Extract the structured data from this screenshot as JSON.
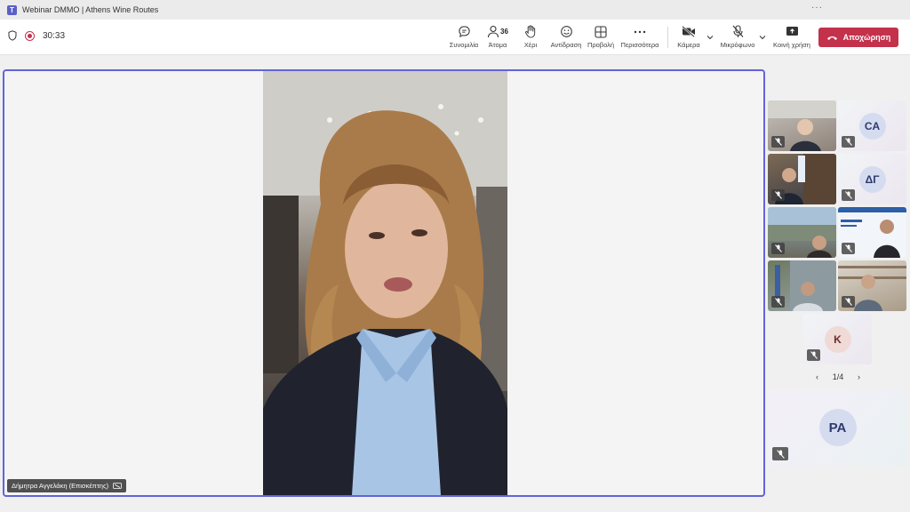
{
  "window": {
    "title": "Webinar DMMO | Athens Wine Routes",
    "more": "···"
  },
  "meeting": {
    "timer": "30:33"
  },
  "toolbar": {
    "chat": "Συνομιλία",
    "people": "Άτομα",
    "people_count": "36",
    "raise": "Χέρι",
    "react": "Αντίδραση",
    "view": "Προβολή",
    "more": "Περισσότερα",
    "camera": "Κάμερα",
    "mic": "Μικρόφωνο",
    "share": "Κοινή χρήση",
    "leave": "Αποχώρηση"
  },
  "stage": {
    "speaker": "Δήμητρα Αγγελάκη (Επισκέπτης)"
  },
  "participants": {
    "avatars": {
      "ca": "CA",
      "dg": "ΔΓ",
      "k": "K",
      "ra": "PA"
    },
    "page": "1/4",
    "prev": "‹",
    "next": "›"
  },
  "colors": {
    "accent": "#6264d8",
    "leave": "#c4314b"
  }
}
